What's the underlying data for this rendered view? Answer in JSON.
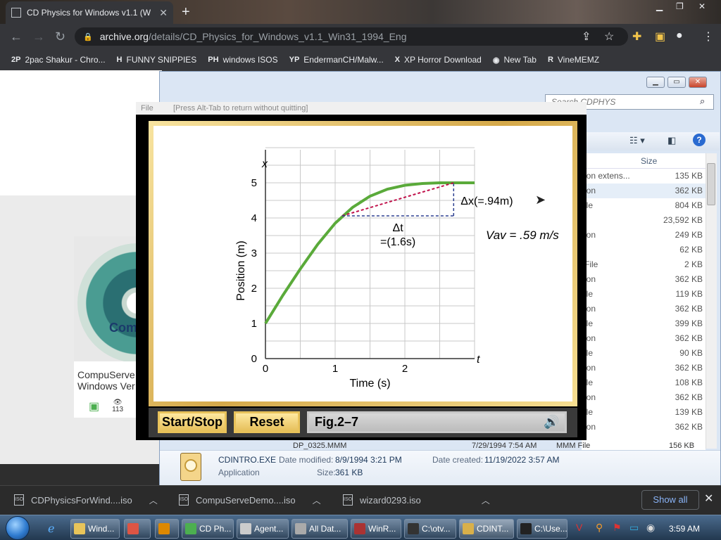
{
  "browser": {
    "tab_title": "CD Physics for Windows v1.1 (W",
    "tab_close": "✕",
    "new_tab": "+",
    "url_host": "archive.org",
    "url_path": "/details/CD_Physics_for_Windows_v1.1_Win31_1994_Eng",
    "bookmarks": [
      {
        "icon": "2P",
        "label": "2pac Shakur - Chro..."
      },
      {
        "icon": "H",
        "label": "FUNNY SNIPPIES"
      },
      {
        "icon": "PH",
        "label": "windows ISOS"
      },
      {
        "icon": "YP",
        "label": "EndermanCH/Malw..."
      },
      {
        "icon": "X",
        "label": "XP Horror Download"
      },
      {
        "icon": "◉",
        "label": "New Tab"
      },
      {
        "icon": "R",
        "label": "VineMEMZ"
      }
    ]
  },
  "page": {
    "item_title": "CompuServe Windows Ver",
    "views": "113",
    "disc_label": "CompuS"
  },
  "explorer": {
    "search_placeholder": "Search CDPHYS",
    "size_header": "Size",
    "rows": [
      {
        "type": "ion extens...",
        "size": "135 KB"
      },
      {
        "type": "ion",
        "size": "362 KB",
        "selected": true
      },
      {
        "type": "ile",
        "size": "804 KB"
      },
      {
        "type": "",
        "size": "23,592 KB"
      },
      {
        "type": "ion",
        "size": "249 KB"
      },
      {
        "type": "",
        "size": "62 KB"
      },
      {
        "type": "File",
        "size": "2 KB"
      },
      {
        "type": "ion",
        "size": "362 KB"
      },
      {
        "type": "ile",
        "size": "119 KB"
      },
      {
        "type": "ion",
        "size": "362 KB"
      },
      {
        "type": "ile",
        "size": "399 KB"
      },
      {
        "type": "ion",
        "size": "362 KB"
      },
      {
        "type": "ile",
        "size": "90 KB"
      },
      {
        "type": "ion",
        "size": "362 KB"
      },
      {
        "type": "ile",
        "size": "108 KB"
      },
      {
        "type": "ion",
        "size": "362 KB"
      },
      {
        "type": "ile",
        "size": "139 KB"
      },
      {
        "type": "ion",
        "size": "362 KB"
      }
    ],
    "last_row": {
      "name": "DP_0325.MMM",
      "date": "7/29/1994 7:54 AM",
      "type": "MMM File",
      "size": "156 KB"
    },
    "details": {
      "file_name": "CDINTRO.EXE",
      "file_type": "Application",
      "modified_label": "Date modified:",
      "modified_value": "8/9/1994 3:21 PM",
      "size_label": "Size:",
      "size_value": "361 KB",
      "created_label": "Date created:",
      "created_value": "11/19/2022 3:57 AM"
    }
  },
  "app": {
    "menu_file": "File",
    "hint": "[Press Alt-Tab to return without quitting]",
    "start_stop": "Start/Stop",
    "reset": "Reset",
    "figure": "Fig.2–7"
  },
  "chart_data": {
    "type": "line",
    "xlabel": "Time (s)",
    "ylabel": "Position (m)",
    "x_axis_symbol": "t",
    "y_axis_symbol": "x",
    "xlim": [
      0,
      3
    ],
    "ylim": [
      0,
      6
    ],
    "x_ticks": [
      "0",
      "1",
      "2"
    ],
    "y_ticks": [
      "0",
      "1",
      "2",
      "3",
      "4",
      "5"
    ],
    "grid": true,
    "series": [
      {
        "color": "#5aaa3a",
        "x": [
          0,
          0.25,
          0.5,
          0.75,
          1.0,
          1.25,
          1.5,
          1.75,
          2.0,
          2.25,
          2.5,
          2.75,
          3.0
        ],
        "y": [
          1.0,
          1.8,
          2.55,
          3.25,
          3.85,
          4.3,
          4.62,
          4.82,
          4.93,
          4.98,
          5.0,
          5.0,
          5.0
        ]
      }
    ],
    "secant": {
      "x0": 1.1,
      "y0": 4.06,
      "x1": 2.7,
      "y1": 5.0,
      "color": "#c0104a"
    },
    "delta_x_label": "Δx(=.94m)",
    "delta_t_label": "Δt",
    "delta_t_value": "=(1.6s)",
    "vav_label": "Vav = .59 m/s"
  },
  "downloads": [
    {
      "name": "CDPhysicsForWind....iso"
    },
    {
      "name": "CompuServeDemo....iso"
    },
    {
      "name": "wizard0293.iso"
    }
  ],
  "show_all": "Show all",
  "taskbar": {
    "items": [
      {
        "label": "Wind...",
        "color": "#e8c45a"
      },
      {
        "label": "",
        "color": "#d54"
      },
      {
        "label": "",
        "color": "#d80"
      },
      {
        "label": "CD Ph...",
        "color": "#4caf50"
      },
      {
        "label": "Agent...",
        "color": "#ccc"
      },
      {
        "label": "All Dat...",
        "color": "#aaa"
      },
      {
        "label": "WinR...",
        "color": "#a33"
      },
      {
        "label": "C:\\otv...",
        "color": "#333"
      },
      {
        "label": "CDINT...",
        "color": "#d9b04a"
      },
      {
        "label": "C:\\Use...",
        "color": "#222"
      }
    ],
    "clock": "3:59 AM"
  },
  "colors": {
    "accent": "#8ab4f8",
    "plot_line": "#5aaa3a",
    "secant": "#c0104a",
    "frame": "#d5a94a"
  }
}
